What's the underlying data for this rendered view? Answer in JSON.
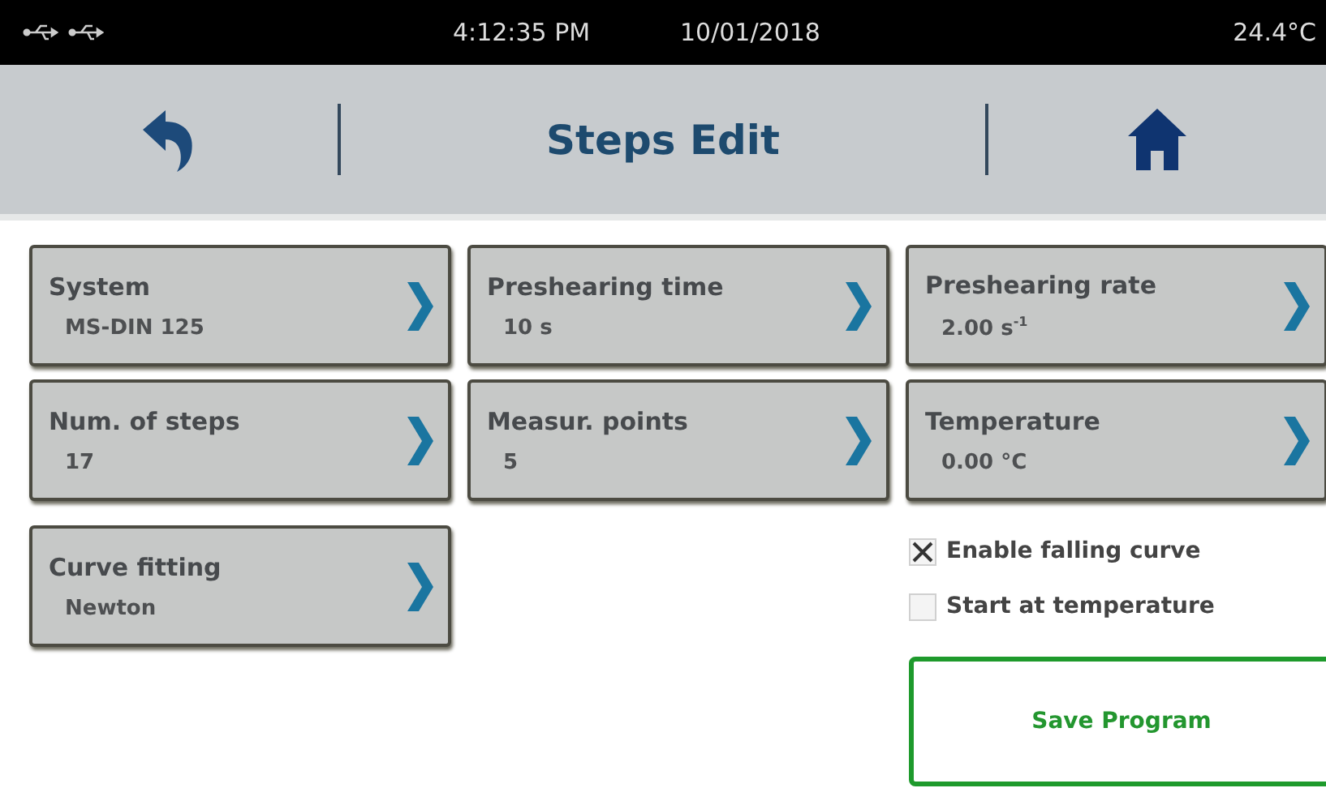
{
  "status_bar": {
    "time": "4:12:35 PM",
    "date": "10/01/2018",
    "temperature": "24.4°C"
  },
  "header": {
    "title": "Steps Edit"
  },
  "parameters": [
    {
      "label": "System",
      "value": "MS-DIN 125"
    },
    {
      "label": "Preshearing time",
      "value": "10 s"
    },
    {
      "label": "Preshearing rate",
      "value": "2.00 s$^{-1}$"
    },
    {
      "label": "Num. of steps",
      "value": "17"
    },
    {
      "label": "Measur. points",
      "value": "5"
    },
    {
      "label": "Temperature",
      "value": "0.00 °C"
    },
    {
      "label": "Curve fitting",
      "value": "Newton"
    }
  ],
  "options": [
    {
      "label": "Enable falling curve",
      "checked": true
    },
    {
      "label": "Start at temperature",
      "checked": false
    }
  ],
  "save_button": {
    "label": "Save Program"
  }
}
